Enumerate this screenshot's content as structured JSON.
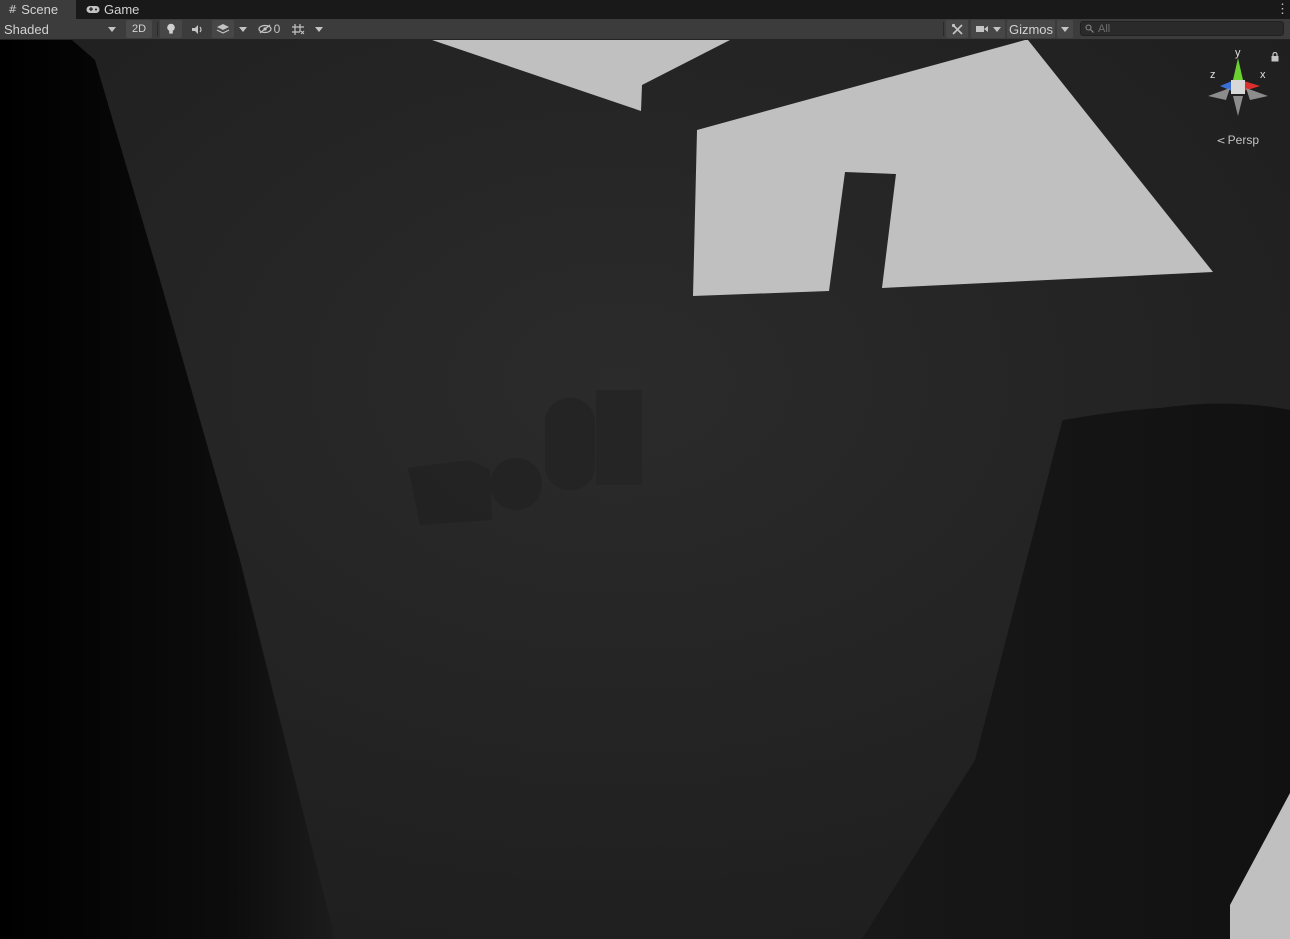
{
  "tabs": [
    {
      "label": "Scene",
      "icon": "grid-icon",
      "active": true
    },
    {
      "label": "Game",
      "icon": "gamepad-icon",
      "active": false
    }
  ],
  "toolbar": {
    "draw_mode": "Shaded",
    "btn_2d": "2D",
    "hidden_count": "0",
    "gizmos_label": "Gizmos",
    "search_placeholder": "All"
  },
  "viewport": {
    "projection_label": "Persp",
    "axis_labels": {
      "x": "x",
      "y": "y",
      "z": "z"
    },
    "colors": {
      "x_axis": "#db2e2e",
      "y_axis": "#6ad12f",
      "z_axis": "#3a6fd8",
      "background": "#262626"
    }
  }
}
